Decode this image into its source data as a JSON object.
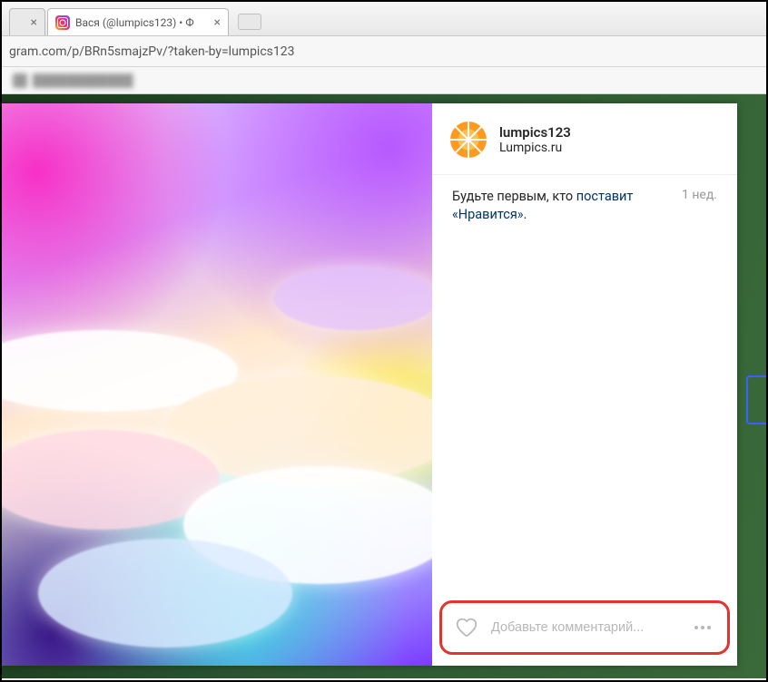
{
  "browser": {
    "tab_title": "Вася (@lumpics123) • Ф",
    "url": "gram.com/p/BRn5smajzPv/?taken-by=lumpics123"
  },
  "post": {
    "username": "lumpics123",
    "subtitle": "Lumpics.ru",
    "likes_prefix": "Будьте первым, кто ",
    "likes_link": "поставит «Нравится»",
    "likes_suffix": ".",
    "time": "1 нед.",
    "comment_placeholder": "Добавьте комментарий..."
  }
}
